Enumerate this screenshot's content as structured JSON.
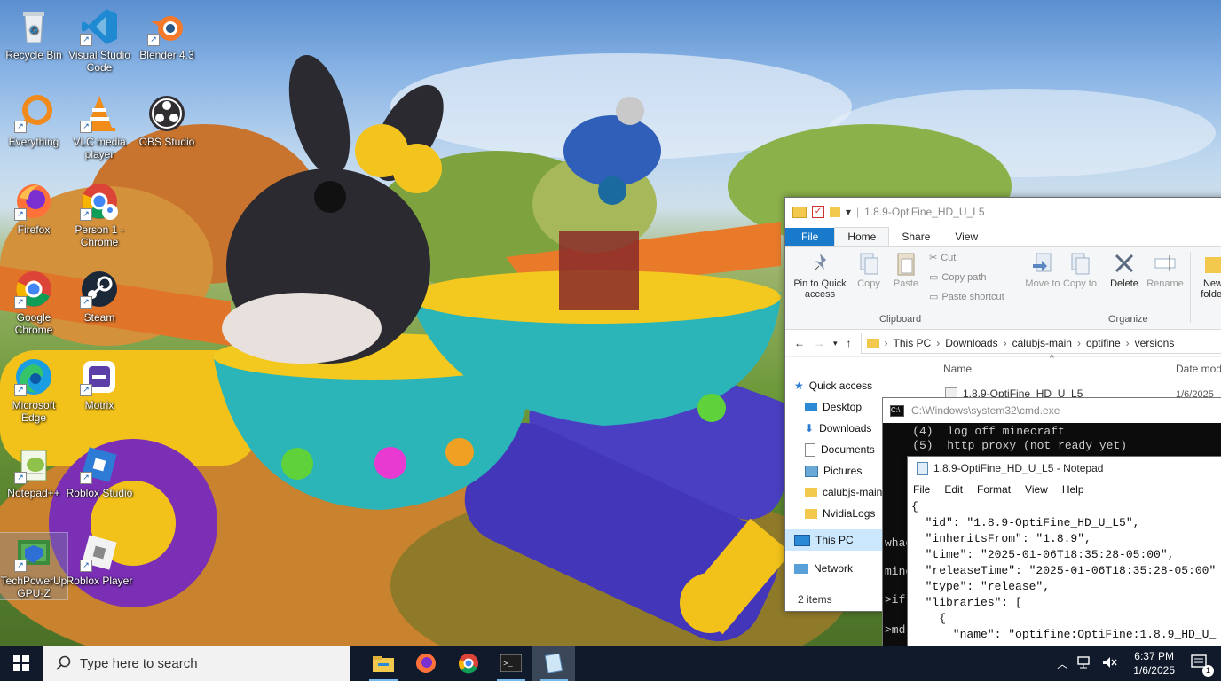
{
  "desktop": {
    "icons": [
      {
        "label": "Recycle Bin",
        "icon": "recycle-bin-icon"
      },
      {
        "label": "Visual Studio Code",
        "icon": "vscode-icon"
      },
      {
        "label": "Blender 4.3",
        "icon": "blender-icon"
      },
      {
        "label": "Everything",
        "icon": "everything-search-icon"
      },
      {
        "label": "VLC media player",
        "icon": "vlc-icon"
      },
      {
        "label": "OBS Studio",
        "icon": "obs-icon"
      },
      {
        "label": "Firefox",
        "icon": "firefox-icon"
      },
      {
        "label": "Person 1 - Chrome",
        "icon": "chrome-profile-icon"
      },
      {
        "label": "Google Chrome",
        "icon": "chrome-icon"
      },
      {
        "label": "Steam",
        "icon": "steam-icon"
      },
      {
        "label": "Microsoft Edge",
        "icon": "edge-icon"
      },
      {
        "label": "Motrix",
        "icon": "motrix-icon"
      },
      {
        "label": "Notepad++",
        "icon": "notepadpp-icon"
      },
      {
        "label": "Roblox Studio",
        "icon": "roblox-studio-icon"
      },
      {
        "label": "TechPowerUp GPU-Z",
        "icon": "gpuz-icon"
      },
      {
        "label": "Roblox Player",
        "icon": "roblox-player-icon"
      }
    ]
  },
  "explorer": {
    "title": "1.8.9-OptiFine_HD_U_L5",
    "tabs": {
      "file": "File",
      "home": "Home",
      "share": "Share",
      "view": "View"
    },
    "ribbon": {
      "pin": "Pin to Quick access",
      "copy": "Copy",
      "paste": "Paste",
      "cut": "Cut",
      "copy_path": "Copy path",
      "paste_shortcut": "Paste shortcut",
      "clipboard_group": "Clipboard",
      "move_to": "Move to",
      "copy_to": "Copy to",
      "delete": "Delete",
      "rename": "Rename",
      "new_folder": "New folder",
      "organize_group": "Organize"
    },
    "path": [
      "This PC",
      "Downloads",
      "calubjs-main",
      "optifine",
      "versions"
    ],
    "columns": {
      "name": "Name",
      "date": "Date mod"
    },
    "file_row": {
      "name": "1.8.9-OptiFine_HD_U_L5",
      "date": "1/6/2025"
    },
    "nav": [
      "Quick access",
      "Desktop",
      "Downloads",
      "Documents",
      "Pictures",
      "calubjs-main",
      "NvidiaLogs",
      "This PC",
      "Network"
    ],
    "status": "2 items"
  },
  "cmd": {
    "title": "C:\\Windows\\system32\\cmd.exe",
    "line1": "    (4)  log off minecraft",
    "line2": "    (5)  http proxy (not ready yet)",
    "frag1": "whac",
    "frag2": "mine",
    "frag3": ">if",
    "frag4": ">md"
  },
  "notepad": {
    "title": "1.8.9-OptiFine_HD_U_L5 - Notepad",
    "menu": [
      "File",
      "Edit",
      "Format",
      "View",
      "Help"
    ],
    "lines": [
      "{",
      "  \"id\": \"1.8.9-OptiFine_HD_U_L5\",",
      "  \"inheritsFrom\": \"1.8.9\",",
      "  \"time\": \"2025-01-06T18:35:28-05:00\",",
      "  \"releaseTime\": \"2025-01-06T18:35:28-05:00\"",
      "  \"type\": \"release\",",
      "  \"libraries\": [",
      "    {",
      "      \"name\": \"optifine:OptiFine:1.8.9_HD_U_"
    ]
  },
  "taskbar": {
    "search_placeholder": "Type here to search",
    "time": "6:37 PM",
    "date": "1/6/2025",
    "notification_count": "1",
    "apps": [
      "file-explorer-icon",
      "firefox-icon",
      "chrome-icon",
      "cmd-icon",
      "notepad-icon"
    ]
  }
}
